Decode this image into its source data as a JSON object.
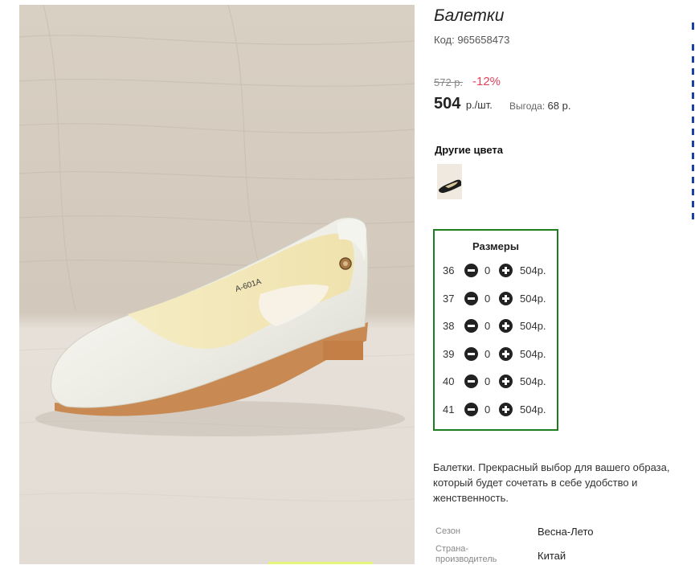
{
  "product": {
    "title": "Балетки",
    "code": "Код: 965658473",
    "old_price": "572 р.",
    "discount": "-12%",
    "price": "504",
    "price_unit": "р./шт.",
    "saving_label": "Выгода:",
    "saving_value": "68 р.",
    "sole_text": "A-601A"
  },
  "colors": {
    "title": "Другие цвета"
  },
  "sizes": {
    "title": "Размеры",
    "rows": [
      {
        "size": "36",
        "qty": "0",
        "price": "504р."
      },
      {
        "size": "37",
        "qty": "0",
        "price": "504р."
      },
      {
        "size": "38",
        "qty": "0",
        "price": "504р."
      },
      {
        "size": "39",
        "qty": "0",
        "price": "504р."
      },
      {
        "size": "40",
        "qty": "0",
        "price": "504р."
      },
      {
        "size": "41",
        "qty": "0",
        "price": "504р."
      }
    ]
  },
  "description": "Балетки. Прекрасный выбор для вашего образа, который будет сочетать в себе удобство и женственность.",
  "specs": [
    {
      "label": "Сезон",
      "value": "Весна-Лето"
    },
    {
      "label": "Страна-производитель",
      "value": "Китай"
    }
  ],
  "colors_palette": {
    "sizes_border": "#1e7d1e",
    "discount": "#e0425c",
    "sidebar_accent": "#1b3fa5"
  }
}
